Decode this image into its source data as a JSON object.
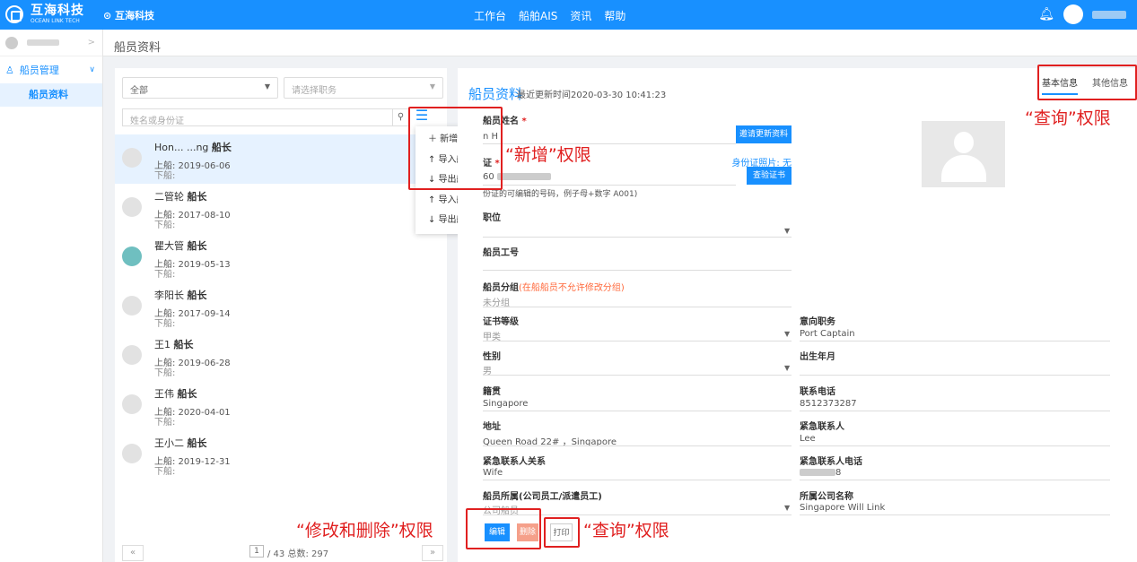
{
  "topbar": {
    "brand_title": "互海科技",
    "brand_subtitle": "OCEAN LINK TECH",
    "company": "⊙ 互海科技",
    "nav": [
      "工作台",
      "船舶AIS",
      "资讯",
      "帮助"
    ]
  },
  "sidebar": {
    "group": "船员管理",
    "item": "船员资料"
  },
  "page_title": "船员资料",
  "left": {
    "filter_all": "全部",
    "filter_position_placeholder": "请选择职务",
    "search_placeholder": "姓名或身份证",
    "crew": [
      {
        "name": "Hon... ...ng",
        "rank": "船长",
        "board": "上船:  2019-06-06",
        "leave": "下船:",
        "active": true
      },
      {
        "name": "二管轮",
        "rank": "船长",
        "board": "上船:  2017-08-10",
        "leave": "下船:"
      },
      {
        "name": "瞿大管",
        "rank": "船长",
        "board": "上船:  2019-05-13",
        "leave": "下船:"
      },
      {
        "name": "李阳长",
        "rank": "船长",
        "board": "上船:  2017-09-14",
        "leave": "下船:"
      },
      {
        "name": "王1",
        "rank": "船长",
        "board": "上船:  2019-06-28",
        "leave": "下船:"
      },
      {
        "name": "王伟",
        "rank": "船长",
        "board": "上船:  2020-04-01",
        "leave": "下船:"
      },
      {
        "name": "王小二",
        "rank": "船长",
        "board": "上船:  2019-12-31",
        "leave": "下船:"
      }
    ],
    "pager": {
      "prev": "«",
      "next": "»",
      "page": "1",
      "info": "/ 43 总数: 297"
    }
  },
  "dropdown": [
    "＋ 新增船员信息",
    "↑ 导入船员信息",
    "↓ 导出船员信息",
    "↑ 导入船员证书",
    "↓ 导出船员证书"
  ],
  "detail": {
    "title": "船员资料",
    "updated": "最近更新时间2020-03-30 10:41:23",
    "tabs": [
      "基本信息",
      "其他信息"
    ],
    "name_label": "船员姓名",
    "name_value": "n H",
    "invite_btn": "邀请更新资料",
    "id_label": "证",
    "id_value": "60",
    "id_photo": "身份证照片: 无",
    "verify_btn": "查验证书",
    "id_hint": "份证的可编辑的号码，例子母+数字 A001)",
    "position_label": "职位",
    "workno_label": "船员工号",
    "group_label": "船员分组",
    "group_note": "(在船船员不允许修改分组)",
    "group_value": "未分组",
    "cert_label": "证书等级",
    "cert_value": "甲类",
    "intent_label": "意向职务",
    "intent_value": "Port Captain",
    "gender_label": "性别",
    "gender_value": "男",
    "birth_label": "出生年月",
    "native_label": "籍贯",
    "native_value": "Singapore",
    "phone_label": "联系电话",
    "phone_value": "8512373287",
    "addr_label": "地址",
    "addr_value": "Queen Road 22# ，Singapore",
    "contact_label": "紧急联系人",
    "contact_value": "Lee",
    "relation_label": "紧急联系人关系",
    "relation_value": "Wife",
    "ephone_label": "紧急联系人电话",
    "ephone_value": "8",
    "belong_label": "船员所属(公司员工/派遣员工)",
    "belong_value": "公司船员",
    "company_label": "所属公司名称",
    "company_value": "Singapore Will Link",
    "edit_btn": "编辑",
    "delete_btn": "删除",
    "print_btn": "打印"
  },
  "annotations": {
    "query_top": "“查询”权限",
    "add": "“新增”权限",
    "edit_delete": "“修改和删除”权限",
    "query_bottom": "“查询”权限"
  },
  "colors": {
    "primary": "#1890ff",
    "annotation": "#e02020",
    "delete": "#f5a08a"
  }
}
